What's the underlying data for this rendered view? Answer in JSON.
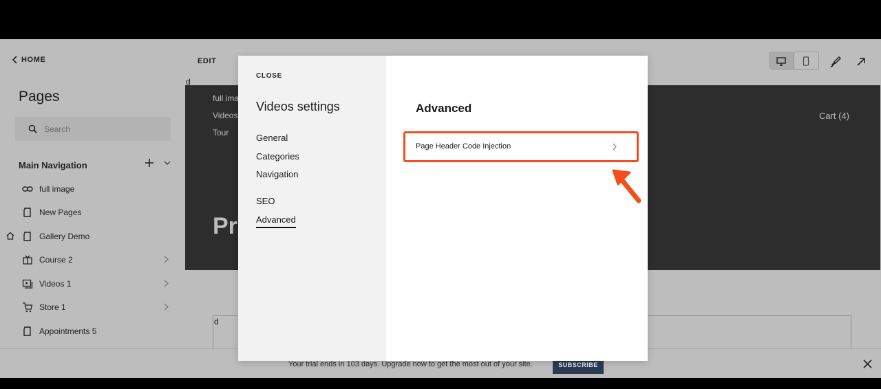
{
  "sidebar": {
    "home_label": "HOME",
    "pages_title": "Pages",
    "search_placeholder": "Search",
    "section_title": "Main Navigation",
    "items": [
      {
        "label": "full image",
        "icon": "link-icon"
      },
      {
        "label": "New Pages",
        "icon": "page-icon"
      },
      {
        "label": "Gallery Demo",
        "icon": "page-icon",
        "homepage": true
      },
      {
        "label": "Course 2",
        "icon": "course-icon",
        "has_children": true
      },
      {
        "label": "Videos 1",
        "icon": "video-icon",
        "has_children": true
      },
      {
        "label": "Store 1",
        "icon": "cart-icon",
        "has_children": true
      },
      {
        "label": "Appointments 5",
        "icon": "page-icon"
      }
    ]
  },
  "editor": {
    "edit_label": "EDIT",
    "canvas_marker": "d",
    "hero_nav": [
      "full ima",
      "Videos",
      "Tour"
    ],
    "cart_label": "Cart (4)",
    "hero_title_partial": "Pr",
    "content_marker": "d"
  },
  "modal": {
    "close_label": "CLOSE",
    "title": "Videos settings",
    "menu": [
      "General",
      "Categories",
      "Navigation",
      "SEO",
      "Advanced"
    ],
    "active_menu": "Advanced",
    "section_title": "Advanced",
    "settings": [
      {
        "label": "Page Header Code Injection"
      }
    ],
    "highlight_color": "#f24e1e"
  },
  "trial_banner": {
    "text": "Your trial ends in 103 days. Upgrade now to get the most out of your site.",
    "button_label": "SUBSCRIBE"
  }
}
